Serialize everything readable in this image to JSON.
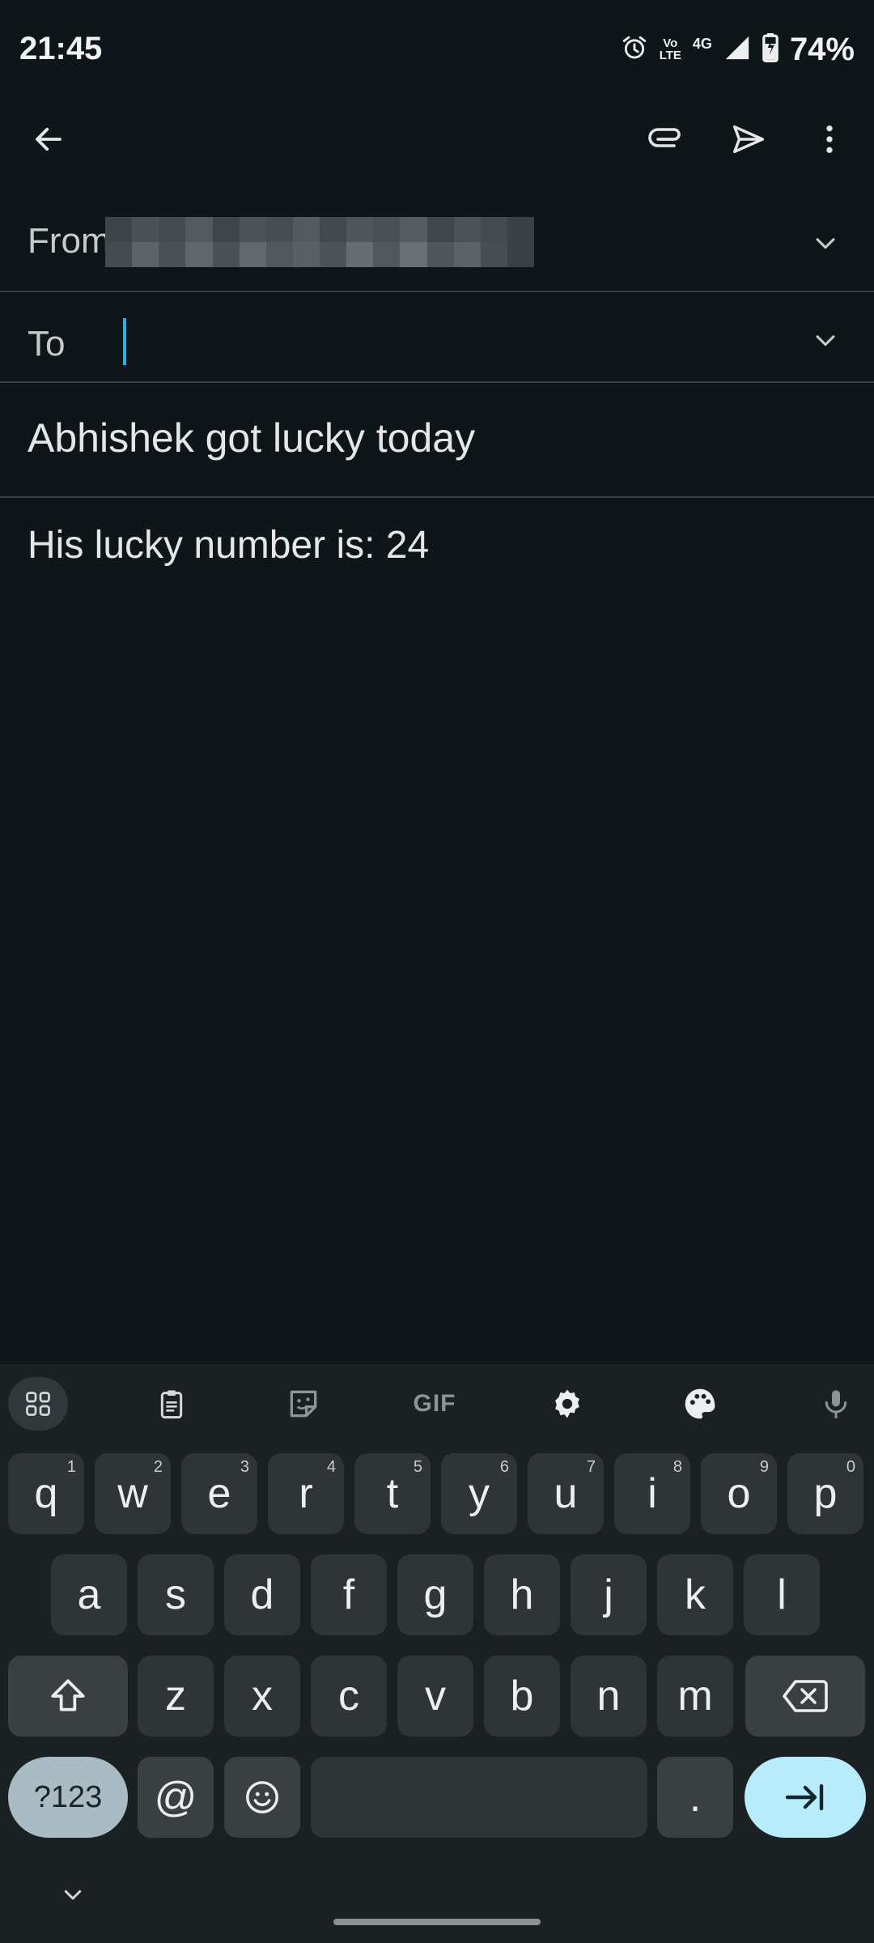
{
  "status": {
    "time": "21:45",
    "lte_top": "Vo",
    "lte_bottom": "LTE",
    "network": "4G",
    "battery": "74%"
  },
  "compose": {
    "from_label": "From",
    "to_label": "To",
    "subject": "Abhishek got lucky today",
    "body": "His lucky number is: 24"
  },
  "toolbar": {
    "gif_label": "GIF"
  },
  "keyboard": {
    "row1": [
      {
        "key": "q",
        "hint": "1"
      },
      {
        "key": "w",
        "hint": "2"
      },
      {
        "key": "e",
        "hint": "3"
      },
      {
        "key": "r",
        "hint": "4"
      },
      {
        "key": "t",
        "hint": "5"
      },
      {
        "key": "y",
        "hint": "6"
      },
      {
        "key": "u",
        "hint": "7"
      },
      {
        "key": "i",
        "hint": "8"
      },
      {
        "key": "o",
        "hint": "9"
      },
      {
        "key": "p",
        "hint": "0"
      }
    ],
    "row2": [
      "a",
      "s",
      "d",
      "f",
      "g",
      "h",
      "j",
      "k",
      "l"
    ],
    "row3": [
      "z",
      "x",
      "c",
      "v",
      "b",
      "n",
      "m"
    ],
    "symbols_label": "?123",
    "at_label": "@",
    "period_label": "."
  },
  "colors": {
    "background": "#0f1619",
    "cursor": "#28b4e6",
    "enter_key": "#b9ecfb"
  }
}
